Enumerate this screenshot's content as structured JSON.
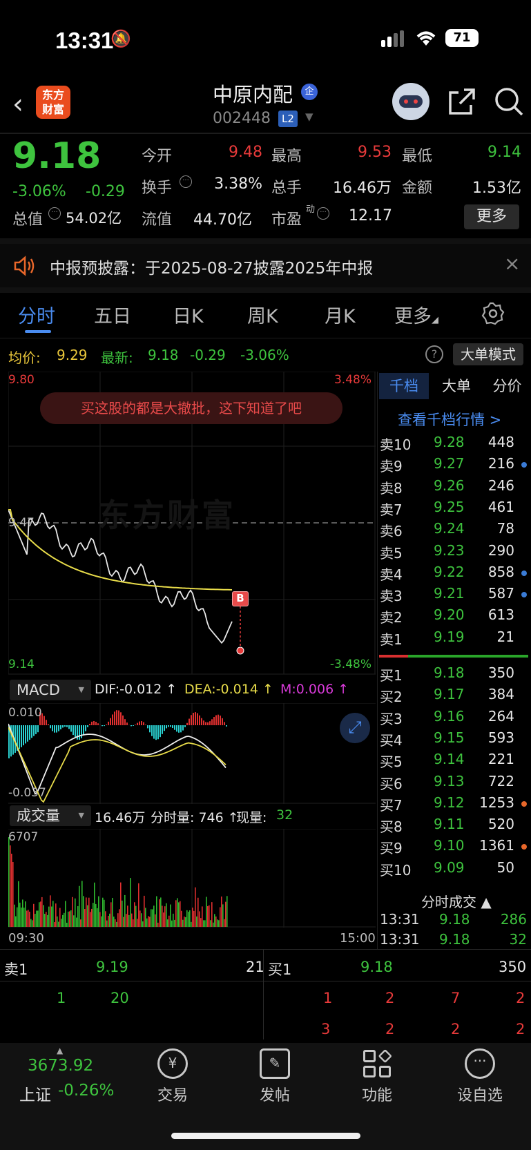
{
  "status": {
    "time": "13:31",
    "battery": "71"
  },
  "header": {
    "logo": "东方\n财富",
    "name": "中原内配",
    "badge": "企",
    "code": "002448",
    "level": "L2"
  },
  "quote": {
    "price": "9.18",
    "pct": "-3.06%",
    "chg": "-0.29",
    "rows": [
      [
        {
          "l": "今开",
          "v": "9.48",
          "c": "red"
        },
        {
          "l": "最高",
          "v": "9.53",
          "c": "red"
        },
        {
          "l": "最低",
          "v": "9.14",
          "c": "green"
        }
      ],
      [
        {
          "l": "换手",
          "v": "3.38%",
          "c": "white"
        },
        {
          "l": "总手",
          "v": "16.46万",
          "c": "white"
        },
        {
          "l": "金额",
          "v": "1.53亿",
          "c": "white"
        }
      ]
    ],
    "total_label": "总值",
    "total_value": "54.02亿",
    "float_label": "流值",
    "float_value": "44.70亿",
    "pe_label": "市盈",
    "pe_sup": "动",
    "pe_value": "12.17",
    "more": "更多"
  },
  "notice": {
    "text": "中报预披露：于2025-08-27披露2025年中报"
  },
  "tabs": [
    "分时",
    "五日",
    "日K",
    "周K",
    "月K",
    "更多"
  ],
  "info_bar": {
    "avg_label": "均价:",
    "avg": "9.29",
    "latest_label": "最新:",
    "latest": "9.18",
    "chg": "-0.29",
    "pct": "-3.06%",
    "mode": "大单模式"
  },
  "chart": {
    "top_price": "9.80",
    "top_pct": "3.48%",
    "mid_price": "9.47",
    "bottom_price": "9.14",
    "bottom_pct": "-3.48%",
    "banner": "买这股的都是大撤批，这下知道了吧",
    "watermark": "东方财富",
    "marker": "B",
    "macd_label": "MACD",
    "dif": "DIF:-0.012 ↑",
    "dea": "DEA:-0.014 ↑",
    "m": "M:0.006 ↑",
    "macd_top": "0.010",
    "macd_bottom": "-0.037",
    "vol_label": "成交量",
    "vol_total": "16.46万",
    "vol_min_label": "分时量: 746 ↑",
    "vol_now_label": "现量:",
    "vol_now": "32",
    "vol_max": "6707",
    "time_start": "09:30",
    "time_end": "15:00"
  },
  "chart_data": {
    "type": "line",
    "x_range": [
      "09:30",
      "15:00"
    ],
    "ylim": [
      9.14,
      9.8
    ]
  },
  "orderbook": {
    "tabs": [
      "千档",
      "大单",
      "分价"
    ],
    "link": "查看千档行情 >",
    "asks": [
      [
        "卖10",
        "9.28",
        "448",
        ""
      ],
      [
        "卖9",
        "9.27",
        "216",
        "#3a7bd5"
      ],
      [
        "卖8",
        "9.26",
        "246",
        ""
      ],
      [
        "卖7",
        "9.25",
        "461",
        ""
      ],
      [
        "卖6",
        "9.24",
        "78",
        ""
      ],
      [
        "卖5",
        "9.23",
        "290",
        ""
      ],
      [
        "卖4",
        "9.22",
        "858",
        "#3a7bd5"
      ],
      [
        "卖3",
        "9.21",
        "587",
        "#3a7bd5"
      ],
      [
        "卖2",
        "9.20",
        "613",
        ""
      ],
      [
        "卖1",
        "9.19",
        "21",
        ""
      ]
    ],
    "bids": [
      [
        "买1",
        "9.18",
        "350",
        ""
      ],
      [
        "买2",
        "9.17",
        "384",
        ""
      ],
      [
        "买3",
        "9.16",
        "264",
        ""
      ],
      [
        "买4",
        "9.15",
        "593",
        ""
      ],
      [
        "买5",
        "9.14",
        "221",
        ""
      ],
      [
        "买6",
        "9.13",
        "722",
        ""
      ],
      [
        "买7",
        "9.12",
        "1253",
        "#e8672a"
      ],
      [
        "买8",
        "9.11",
        "520",
        ""
      ],
      [
        "买9",
        "9.10",
        "1361",
        "#e8672a"
      ],
      [
        "买10",
        "9.09",
        "50",
        ""
      ]
    ],
    "trades_label": "分时成交 ▲",
    "trades": [
      [
        "13:31",
        "9.18",
        "286"
      ],
      [
        "13:31",
        "9.18",
        "32"
      ]
    ]
  },
  "level2": {
    "ask_label": "卖1",
    "ask_price": "9.19",
    "ask_vol": "21",
    "bid_label": "买1",
    "bid_price": "9.18",
    "bid_vol": "350",
    "ask_queue": [
      "1",
      "20"
    ],
    "bid_queue_1": [
      "1",
      "2",
      "7",
      "2"
    ],
    "bid_queue_2": [
      "3",
      "2",
      "2",
      "2"
    ]
  },
  "nav": {
    "index_value": "3673.92",
    "index_label": "上证",
    "index_pct": "-0.26%",
    "items": [
      "交易",
      "发帖",
      "功能",
      "设自选"
    ]
  }
}
